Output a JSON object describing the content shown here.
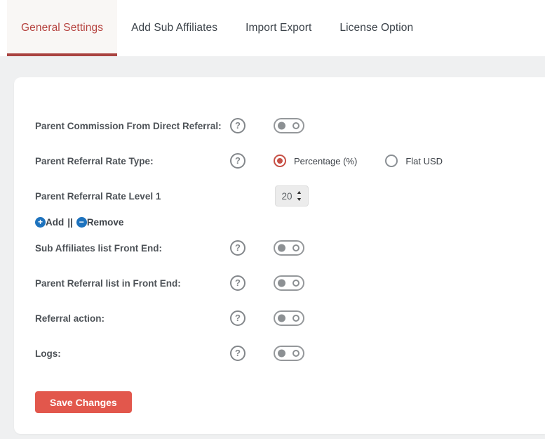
{
  "tabs": {
    "items": [
      {
        "label": "General Settings",
        "active": true
      },
      {
        "label": "Add Sub Affiliates",
        "active": false
      },
      {
        "label": "Import Export",
        "active": false
      },
      {
        "label": "License Option",
        "active": false
      }
    ]
  },
  "icons": {
    "help": "?",
    "add": "+",
    "remove": "−",
    "spinner_up": "▲",
    "spinner_down": "▼"
  },
  "form": {
    "rows": {
      "parent_commission": {
        "label": "Parent Commission From Direct Referral:",
        "toggle_state": "off"
      },
      "rate_type": {
        "label": "Parent Referral Rate Type:",
        "options": [
          {
            "label": "Percentage (%)",
            "selected": true
          },
          {
            "label": "Flat USD",
            "selected": false
          }
        ]
      },
      "rate_level": {
        "label": "Parent Referral Rate Level 1",
        "value": "20",
        "add_label": "Add",
        "separator": "||",
        "remove_label": "Remove"
      },
      "sub_affiliates_list": {
        "label": "Sub Affiliates list Front End:",
        "toggle_state": "off"
      },
      "parent_referral_list": {
        "label": "Parent Referral list in Front End:",
        "toggle_state": "off"
      },
      "referral_action": {
        "label": "Referral action:",
        "toggle_state": "off"
      },
      "logs": {
        "label": "Logs:",
        "toggle_state": "off"
      }
    },
    "save_button": {
      "label": "Save Changes"
    }
  },
  "colors": {
    "page_bg": "#eff0f1",
    "tab_active_text": "#b5423e",
    "tab_active_bg": "#f9f7f5",
    "tab_underline": "#a94340",
    "tab_inactive_text": "#3c434a",
    "label_text": "#4d5257",
    "save_button_bg": "#e2574c",
    "radio_selected": "#c75046",
    "link_circle_blue": "#1e73be",
    "toggle_gray": "#8c9093",
    "number_field_bg": "#ececec"
  }
}
